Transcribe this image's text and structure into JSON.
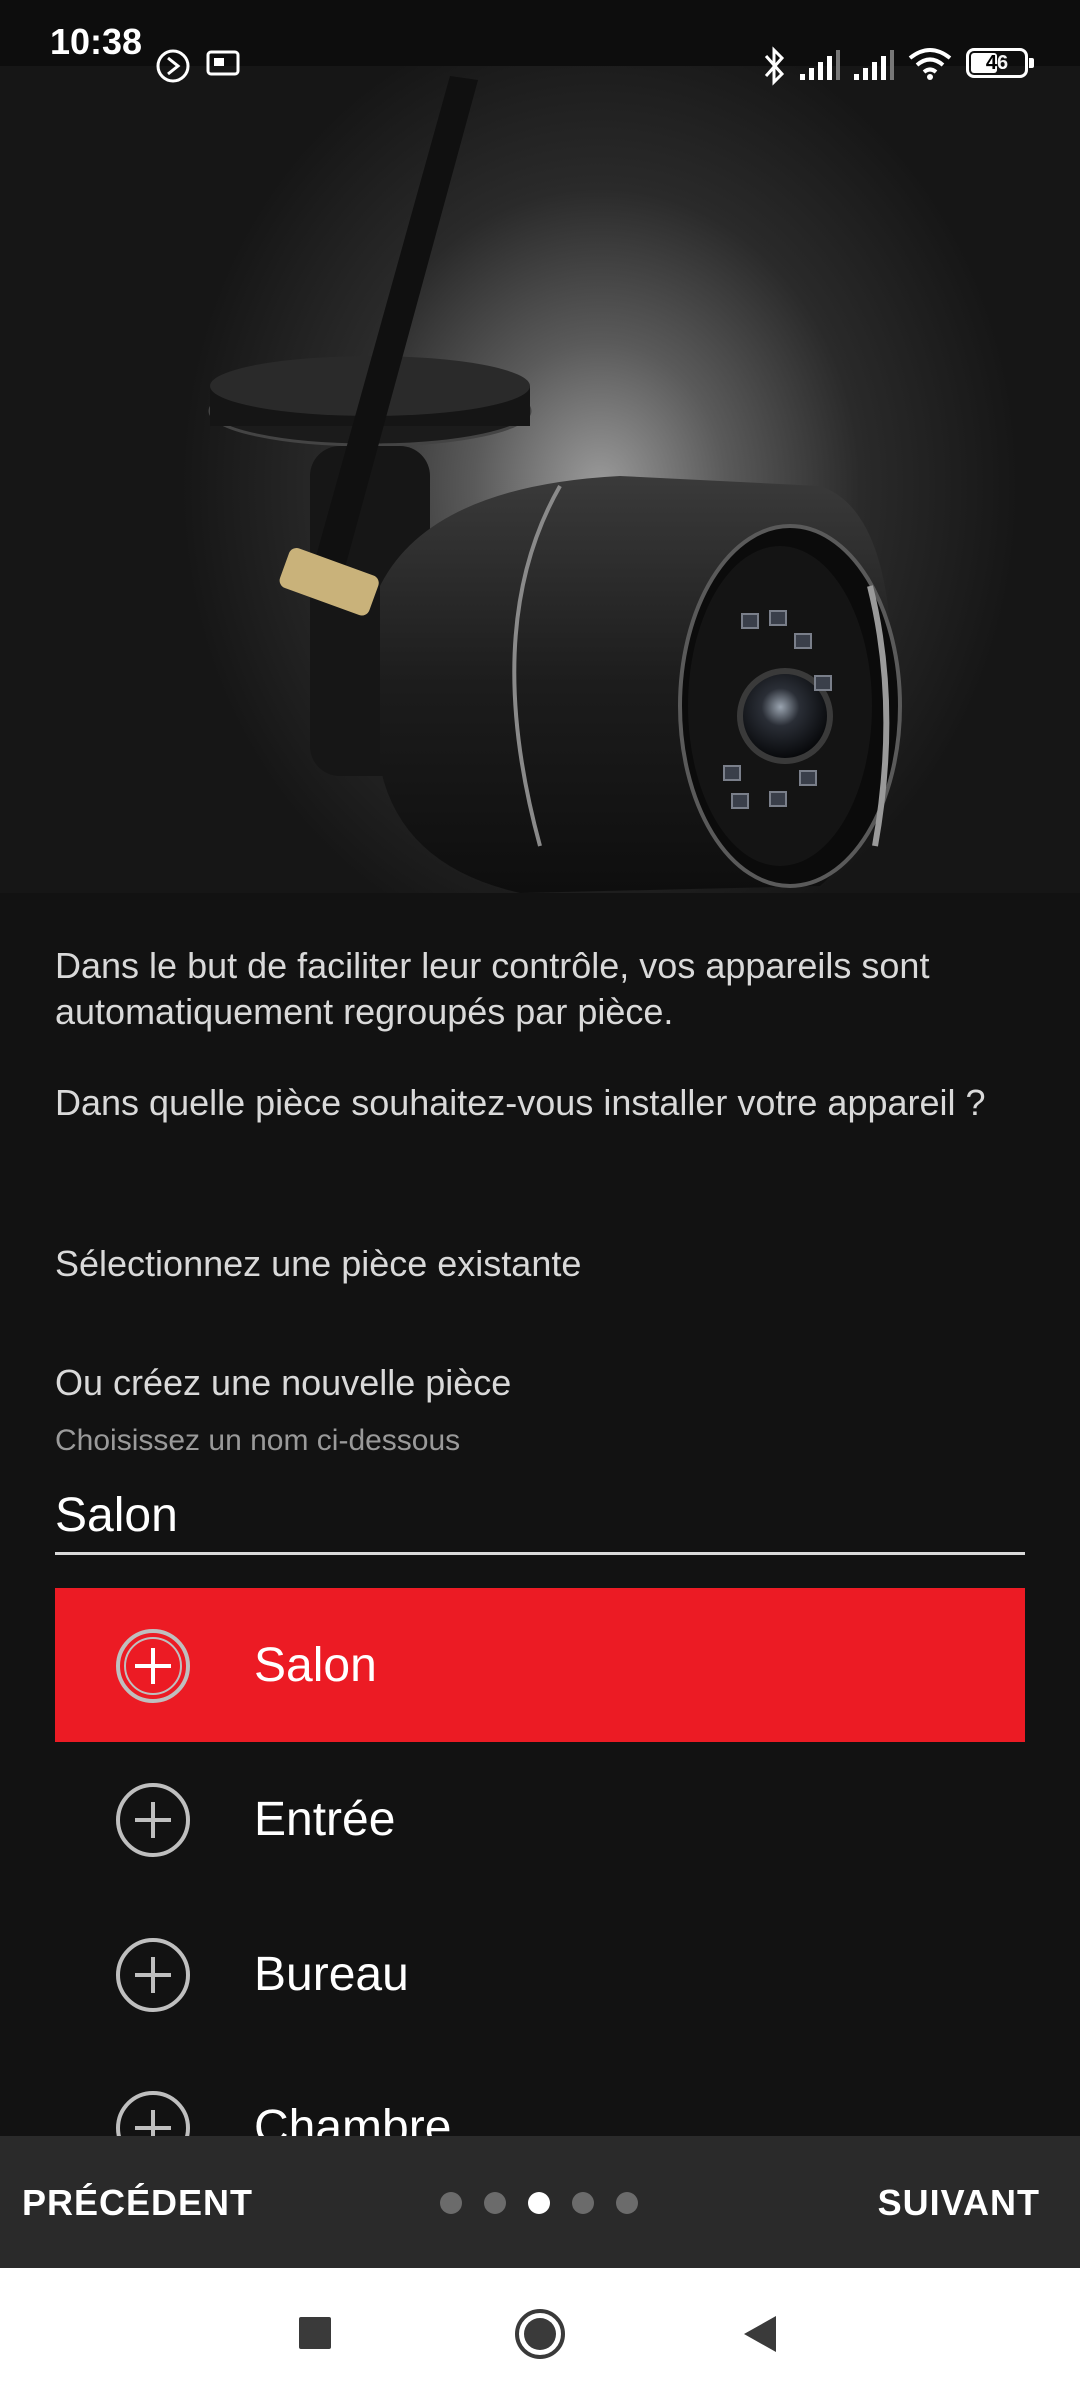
{
  "status_bar": {
    "time": "10:38",
    "battery": "46",
    "icons": [
      "sync-icon",
      "cast-icon",
      "bluetooth-icon",
      "signal-icon",
      "signal-icon",
      "wifi-icon",
      "battery-icon"
    ]
  },
  "hero": {
    "image": "outdoor-security-camera"
  },
  "intro": {
    "text1": "Dans le but de faciliter leur contrôle, vos appareils sont automatiquement regroupés par pièce.",
    "text2": "Dans quelle pièce souhaitez-vous installer votre appareil ?"
  },
  "select_existing_label": "Sélectionnez une pièce existante",
  "new_room": {
    "label": "Ou créez une nouvelle pièce",
    "hint": "Choisissez un nom ci-dessous",
    "value": "Salon"
  },
  "rooms": [
    {
      "label": "Salon",
      "selected": true
    },
    {
      "label": "Entrée",
      "selected": false
    },
    {
      "label": "Bureau",
      "selected": false
    },
    {
      "label": "Chambre",
      "selected": false
    }
  ],
  "navigation": {
    "previous": "PRÉCÉDENT",
    "next": "SUIVANT",
    "page_count": 5,
    "current_page": 3
  },
  "colors": {
    "accent": "#ec1b24",
    "background": "#121212",
    "nav_bar": "#2a2a2a"
  }
}
